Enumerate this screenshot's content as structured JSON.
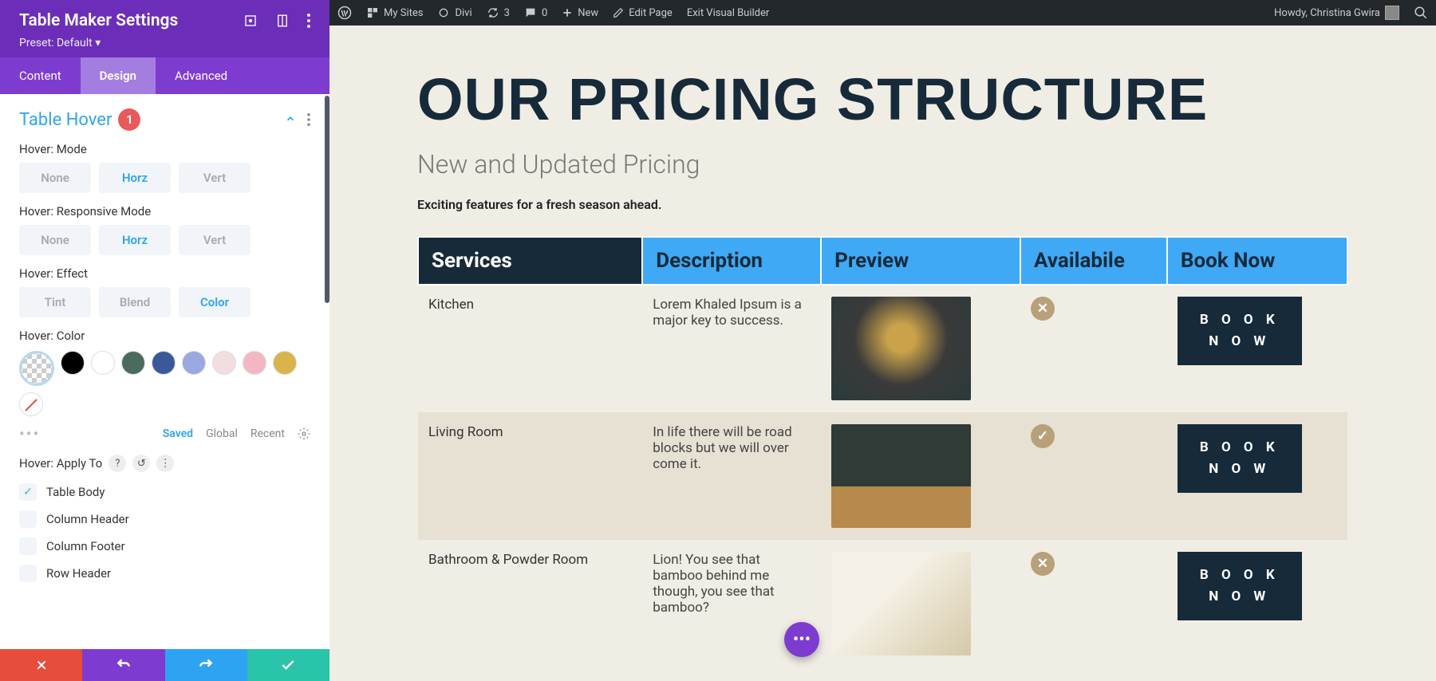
{
  "panel": {
    "title": "Table Maker Settings",
    "preset_label": "Preset: Default",
    "tabs": {
      "content": "Content",
      "design": "Design",
      "advanced": "Advanced"
    },
    "section_title": "Table Hover",
    "badge": "1",
    "fields": {
      "mode_label": "Hover: Mode",
      "responsive_label": "Hover: Responsive Mode",
      "effect_label": "Hover: Effect",
      "color_label": "Hover: Color",
      "apply_label": "Hover: Apply To"
    },
    "options": {
      "none": "None",
      "horz": "Horz",
      "vert": "Vert",
      "tint": "Tint",
      "blend": "Blend",
      "color": "Color"
    },
    "swatches": [
      "#000000",
      "#ffffff",
      "#4b6b5c",
      "#3b5998",
      "#9aa8e0",
      "#f2dede",
      "#f4b6c2",
      "#d9b44a"
    ],
    "color_links": {
      "saved": "Saved",
      "global": "Global",
      "recent": "Recent"
    },
    "checks": [
      {
        "label": "Table Body",
        "checked": true
      },
      {
        "label": "Column Header",
        "checked": false
      },
      {
        "label": "Column Footer",
        "checked": false
      },
      {
        "label": "Row Header",
        "checked": false
      }
    ]
  },
  "adminbar": {
    "mysites": "My Sites",
    "divi": "Divi",
    "updates": "3",
    "comments": "0",
    "new": "New",
    "edit": "Edit Page",
    "exit": "Exit Visual Builder",
    "howdy": "Howdy, Christina Gwira"
  },
  "page": {
    "title": "OUR PRICING STRUCTURE",
    "subtitle": "New and Updated Pricing",
    "desc": "Exciting features for a fresh season ahead.",
    "headers": [
      "Services",
      "Description",
      "Preview",
      "Availabile",
      "Book Now"
    ],
    "book_btn": "B O O K\nN O W",
    "rows": [
      {
        "service": "Kitchen",
        "desc": "Lorem Khaled Ipsum is a major key to success.",
        "avail": false
      },
      {
        "service": "Living Room",
        "desc": "In life there will be road blocks but we will over come it.",
        "avail": true
      },
      {
        "service": "Bathroom & Powder Room",
        "desc": "Lion! You see that bamboo behind me though, you see that bamboo?",
        "avail": false
      }
    ]
  }
}
